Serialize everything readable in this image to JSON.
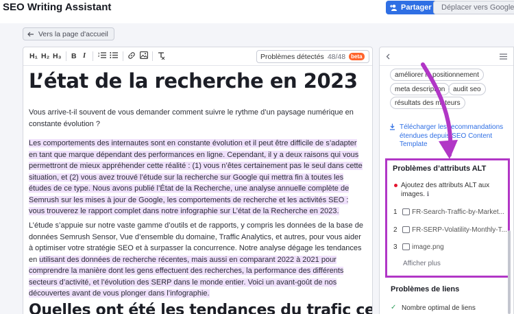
{
  "app": {
    "title": "SEO Writing Assistant"
  },
  "header": {
    "share_label": "Partager",
    "move_label": "Déplacer vers Google D"
  },
  "nav": {
    "back_label": "Vers la page d'accueil"
  },
  "toolbar": {
    "h1": "H₁",
    "h2": "H₂",
    "h3": "H₃",
    "bold": "B",
    "italic": "I",
    "issues_label": "Problèmes détectés",
    "issues_count": "48/48",
    "beta_label": "beta"
  },
  "document": {
    "title": "L’état de la recherche en 2023",
    "intro": "Vous arrive-t-il souvent de vous demander comment suivre le rythme d’un paysage numérique en constante évolution ?",
    "para1": "Les comportements des internautes sont en constante évolution et il peut être difficile de s’adapter en tant que marque dépendant des performances en ligne. Cependant, il y a deux raisons qui vous permettront de mieux appréhender cette réalité : (1) vous n’êtes certainement pas le seul dans cette situation, et (2) vous avez trouvé l’étude sur la recherche sur Google qui mettra fin à toutes les études de ce type. Nous avons publié l’État de la Recherche, une analyse annuelle complète de Semrush sur les mises à jour de Google, les comportements de recherche et les activités SEO : vous trouverez le rapport complet dans notre infographie sur L’état de la Recherche en 2023.",
    "para2_start": "L’étude s’appuie sur notre vaste gamme d’outils et de rapports, y compris les données de la base de données Semrush Sensor, Vue d’ensemble du domaine, Traffic Analytics, et autres, pour vous aider à optimiser votre stratégie SEO et à surpasser la concurrence. Notre analyse dégage les tendances en ",
    "para2_highlight": "utilisant des données de recherche récentes, mais aussi en comparant 2022 à 2021 pour comprendre la manière dont les gens effectuent des recherches, la performance des différents secteurs d’activité, et l’évolution des SERP dans le monde entier. Voici un avant-goût de nos découvertes avant de vous plonger dans l’infographie.",
    "heading2": "Quelles ont été les tendances du trafic cette"
  },
  "sidebar": {
    "keywords": [
      "améliorer le positionnement",
      "meta description",
      "audit seo",
      "résultats des moteurs"
    ],
    "download_label": "Télécharger les recommandations étendues depuis SEO Content Template",
    "alt_section": {
      "title": "Problèmes d’attributs ALT",
      "issue": "Ajoutez des attributs ALT aux images.",
      "files": [
        {
          "num": "1",
          "name": "FR-Search-Traffic-by-Market..."
        },
        {
          "num": "2",
          "name": "FR-SERP-Volatility-Monthly-T..."
        },
        {
          "num": "3",
          "name": "image.png"
        }
      ],
      "more_label": "Afficher plus"
    },
    "links_section": {
      "title": "Problèmes de liens",
      "item": "Nombre optimal de liens"
    }
  },
  "colors": {
    "accent": "#2f6fe4",
    "highlight": "#efe0fb",
    "annotation": "#b136c6",
    "beta": "#ff642d"
  }
}
